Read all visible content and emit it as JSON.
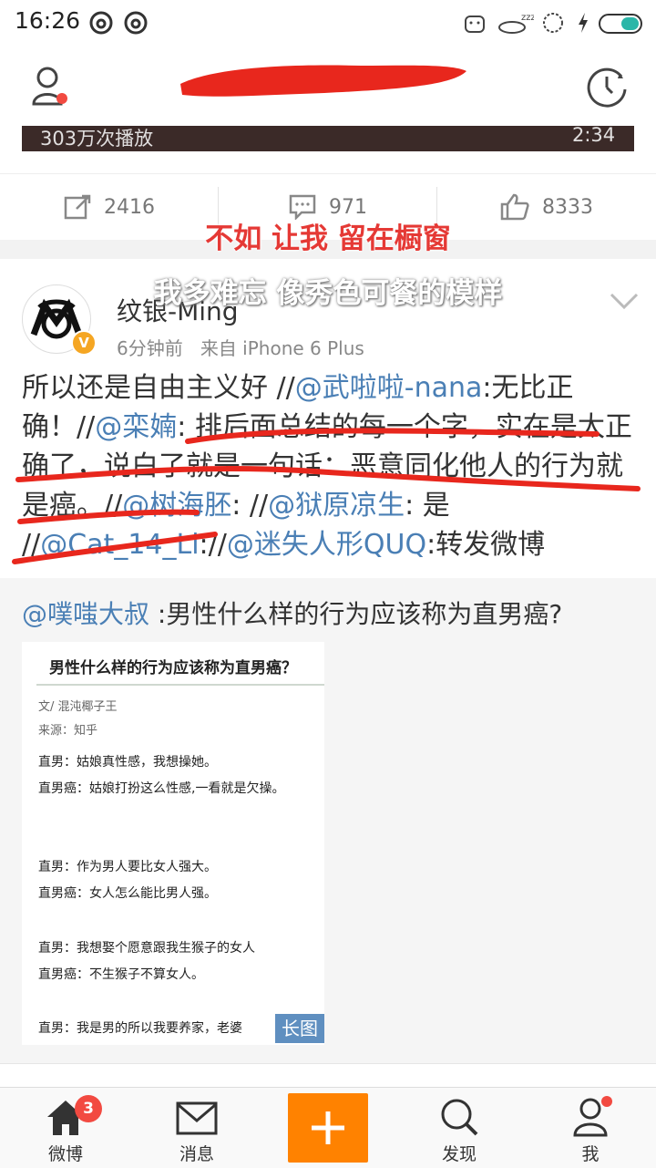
{
  "status_bar": {
    "time": "16:26"
  },
  "video": {
    "play_count": "303万次播放",
    "duration": "2:34"
  },
  "actions": {
    "repost": "2416",
    "comment": "971",
    "like": "8333"
  },
  "lyrics": {
    "line1": "不如 让我 留在橱窗",
    "line2": "我多难忘 像秀色可餐的模样"
  },
  "post": {
    "username": "纹银-Ming",
    "time": "6分钟前",
    "source": "来自 iPhone 6 Plus",
    "body": [
      {
        "t": "所以还是自由主义好 //"
      },
      {
        "t": "@武啦啦-nana",
        "m": true
      },
      {
        "t": ":无比正确！//"
      },
      {
        "t": "@栾婻",
        "m": true
      },
      {
        "t": ": 排后面总结的每一个字，实在是太正确了，说白了就是一句话：恶意同化他人的行为就是癌。//"
      },
      {
        "t": "@树海胚",
        "m": true
      },
      {
        "t": ": //"
      },
      {
        "t": "@狱原凉生",
        "m": true
      },
      {
        "t": ": 是 //"
      },
      {
        "t": "@Cat_14_Li",
        "m": true
      },
      {
        "t": "://"
      },
      {
        "t": "@迷失人形QUQ",
        "m": true
      },
      {
        "t": ":转发微博"
      }
    ]
  },
  "retweet": {
    "author": "@噗嗤大叔",
    "text": " :男性什么样的行为应该称为直男癌?",
    "image": {
      "title": "男性什么样的行为应该称为直男癌？",
      "byline": "文/ 混沌椰子王",
      "source_line": "来源：知乎",
      "lines": [
        "直男：姑娘真性感，我想操她。",
        "直男癌：姑娘打扮这么性感,一看就是欠操。",
        "直男：作为男人要比女人强大。",
        "直男癌：女人怎么能比男人强。",
        "直男：我想娶个愿意跟我生猴子的女人",
        "直男癌：不生猴子不算女人。",
        "直男：我是男的所以我要养家，老婆"
      ]
    },
    "long_badge": "长图"
  },
  "tabbar": {
    "home": "微博",
    "messages": "消息",
    "discover": "发现",
    "me": "我",
    "home_badge": "3"
  },
  "colors": {
    "accent": "#ff8200",
    "mention": "#4a7fb5",
    "badge": "#f24a41"
  }
}
